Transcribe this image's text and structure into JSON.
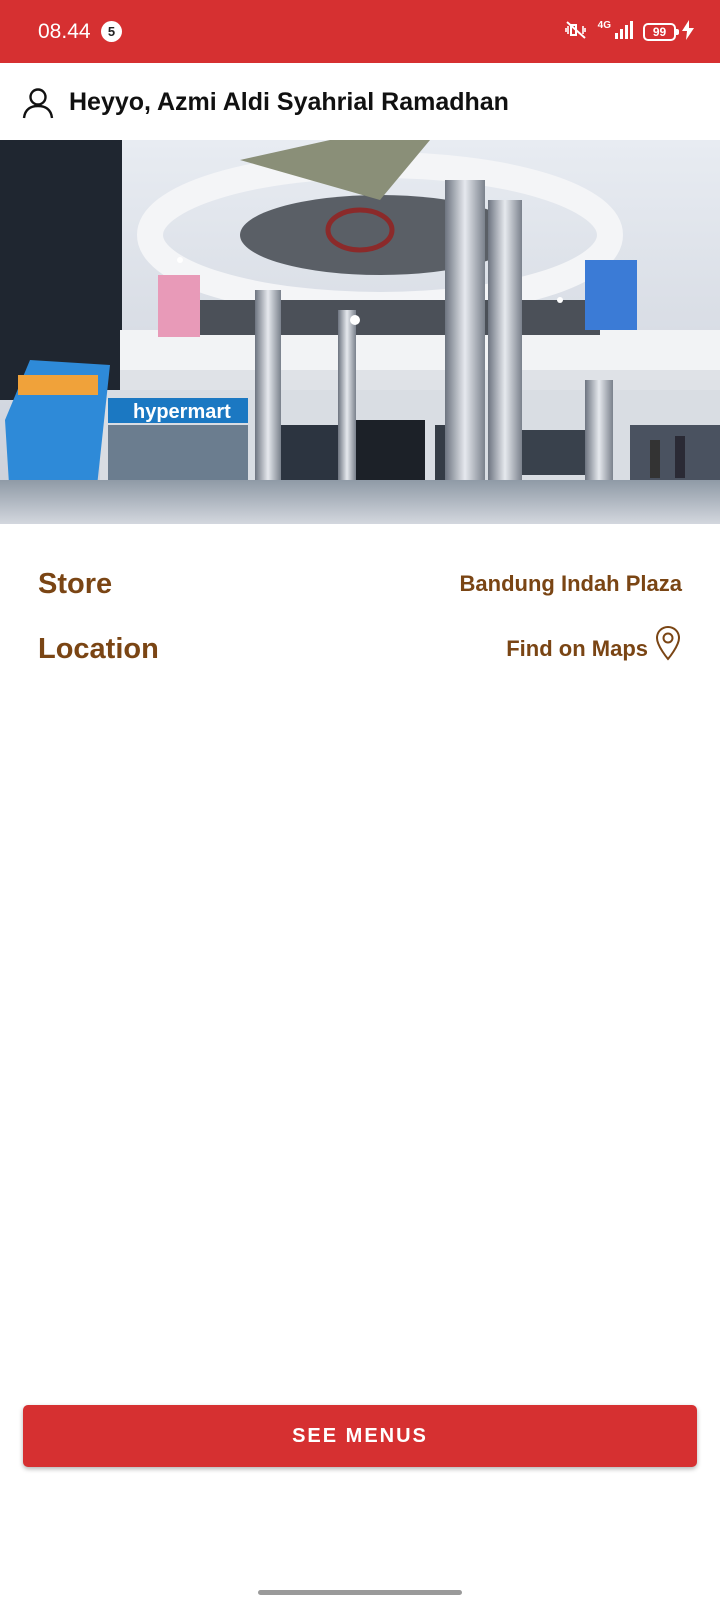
{
  "status_bar": {
    "time": "08.44",
    "notification_count": "5",
    "network": "4G",
    "battery_level": "99"
  },
  "header": {
    "greeting": "Heyyo, Azmi Aldi Syahrial Ramadhan"
  },
  "hero_image": {
    "signs": [
      "hypermart"
    ]
  },
  "details": {
    "store_label": "Store",
    "store_value": "Bandung Indah Plaza",
    "location_label": "Location",
    "location_value": "Find on Maps"
  },
  "see_menus_label": "SEE MENUS",
  "colors": {
    "primary": "#d63031",
    "text_brown": "#7a4514"
  },
  "icons": [
    "user-icon",
    "map-pin-icon",
    "mute-icon",
    "signal-icon",
    "battery-icon",
    "charging-icon"
  ]
}
